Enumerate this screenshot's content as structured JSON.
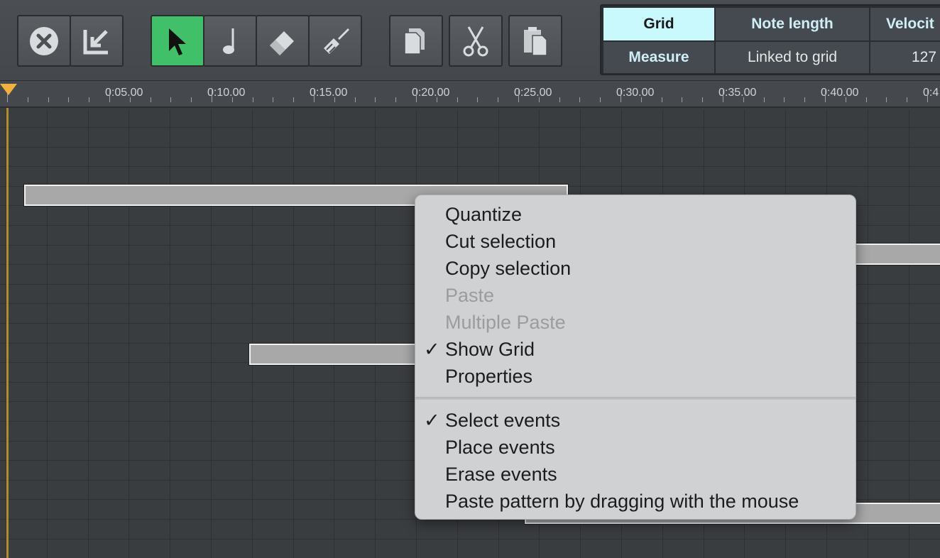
{
  "toolbar": {
    "buttons": [
      {
        "icon": "close-circle-icon"
      },
      {
        "icon": "export-arrow-icon"
      },
      {
        "icon": "select-pointer-icon",
        "active": true
      },
      {
        "icon": "note-icon"
      },
      {
        "icon": "eraser-icon"
      },
      {
        "icon": "paint-brush-icon"
      },
      {
        "icon": "copy-icon"
      },
      {
        "icon": "scissors-icon"
      },
      {
        "icon": "paste-icon"
      }
    ],
    "active_color": "#3fc069"
  },
  "params": {
    "grid_header": "Grid",
    "grid_value": "Measure",
    "note_length_header": "Note length",
    "note_length_value": "Linked to grid",
    "velocity_header": "Velocit",
    "velocity_value": "127"
  },
  "ruler": {
    "labels": [
      "0:05.00",
      "0:10.00",
      "0:15.00",
      "0:20.00",
      "0:25.00",
      "0:30.00",
      "0:35.00",
      "0:40.00",
      "0:4"
    ]
  },
  "menu": {
    "items": [
      {
        "label": "Quantize",
        "enabled": true,
        "checked": false
      },
      {
        "label": "Cut selection",
        "enabled": true,
        "checked": false
      },
      {
        "label": "Copy selection",
        "enabled": true,
        "checked": false
      },
      {
        "label": "Paste",
        "enabled": false,
        "checked": false
      },
      {
        "label": "Multiple Paste",
        "enabled": false,
        "checked": false
      },
      {
        "label": "Show Grid",
        "enabled": true,
        "checked": true
      },
      {
        "label": "Properties",
        "enabled": true,
        "checked": false
      }
    ],
    "items2": [
      {
        "label": "Select events",
        "enabled": true,
        "checked": true
      },
      {
        "label": "Place events",
        "enabled": true,
        "checked": false
      },
      {
        "label": "Erase events",
        "enabled": true,
        "checked": false
      },
      {
        "label": "Paste pattern by dragging with the mouse",
        "enabled": true,
        "checked": false
      }
    ],
    "check_glyph": "✓"
  }
}
